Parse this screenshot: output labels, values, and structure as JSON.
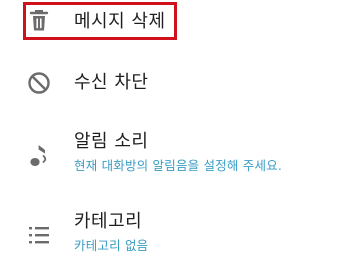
{
  "colors": {
    "accent": "#3a9dc4",
    "highlight": "#d0101a",
    "icon": "#6b6b6b",
    "text": "#1f1f1f"
  },
  "menu": {
    "items": [
      {
        "label": "메시지 삭제",
        "icon": "trash-icon"
      },
      {
        "label": "수신 차단",
        "icon": "block-icon"
      },
      {
        "label": "알림 소리",
        "sublabel": "현재 대화방의 알림음을 설정해 주세요.",
        "icon": "music-note-icon"
      },
      {
        "label": "카테고리",
        "sublabel": "카테고리 없음",
        "icon": "category-list-icon"
      }
    ]
  }
}
